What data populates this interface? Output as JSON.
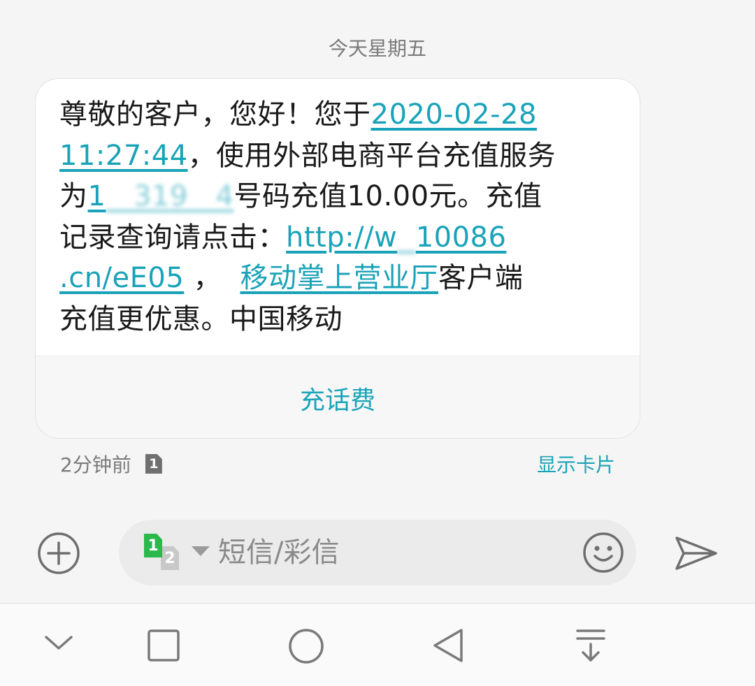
{
  "date_header": "今天星期五",
  "message": {
    "part1": "尊敬的客户，您好！您于",
    "datetime_line1": "2020-02-28",
    "datetime_line2": "11:27:44",
    "part2": "，使用外部电商平台充值服务",
    "part3": "为",
    "phone_visible": "1",
    "phone_obscured": "   319   4",
    "part4": "号码充值10.00元。充值",
    "part5": "记录查询请点击：",
    "url_part1": "http://w",
    "url_obscured": "  ",
    "url_part2": "10086",
    "url_part3": ".cn/eE05",
    "part6": " ，",
    "app_obscured": "  ",
    "app_link": "移动掌上营业厅",
    "part7": "客户端",
    "part8": "充值更优惠。中国移动"
  },
  "action_button": "充话费",
  "meta": {
    "time_ago": "2分钟前",
    "sim_badge": "1",
    "show_card": "显示卡片"
  },
  "composer": {
    "sim1_label": "1",
    "sim2_label": "2",
    "placeholder": "短信/彩信"
  },
  "icons": {
    "add": "add-circle-icon",
    "emoji": "smiley-icon",
    "send": "send-icon",
    "nav_down": "chevron-down-icon",
    "nav_recent": "square-icon",
    "nav_home": "circle-icon",
    "nav_back": "triangle-back-icon",
    "nav_pull": "pull-down-icon"
  },
  "colors": {
    "accent": "#1aa3b8",
    "sim1": "#2bb94b",
    "background": "#f5f5f5",
    "bubble": "#ffffff"
  }
}
